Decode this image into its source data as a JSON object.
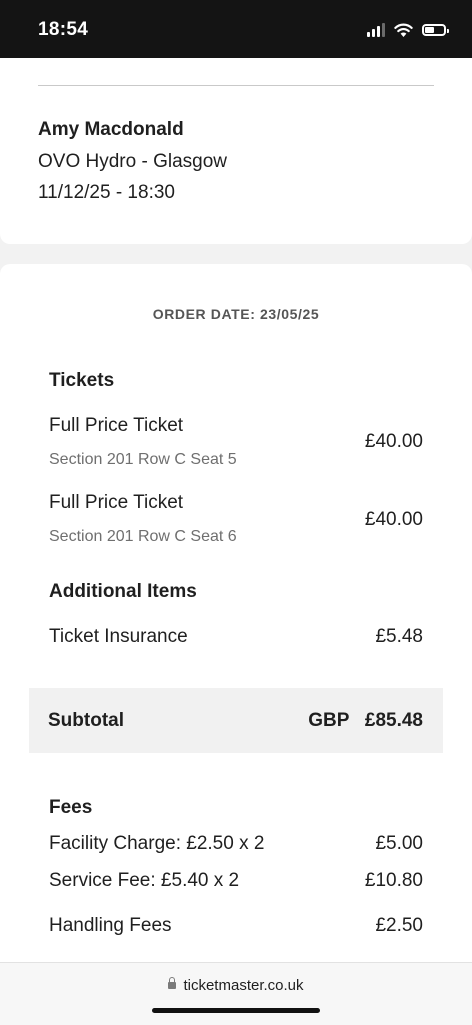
{
  "status_bar": {
    "time": "18:54"
  },
  "event": {
    "artist": "Amy Macdonald",
    "venue": "OVO Hydro - Glasgow",
    "datetime": "11/12/25 - 18:30"
  },
  "order": {
    "order_date": "ORDER DATE: 23/05/25",
    "tickets_heading": "Tickets",
    "tickets": [
      {
        "name": "Full Price Ticket",
        "seat": "Section 201  Row C  Seat 5",
        "price": "£40.00"
      },
      {
        "name": "Full Price Ticket",
        "seat": "Section 201  Row C  Seat 6",
        "price": "£40.00"
      }
    ],
    "additional_heading": "Additional Items",
    "additional_items": [
      {
        "name": "Ticket Insurance",
        "price": "£5.48"
      }
    ],
    "subtotal": {
      "label": "Subtotal",
      "value": "GBP   £85.48"
    },
    "fees_heading": "Fees",
    "fees": [
      {
        "name": "Facility Charge: £2.50 x 2",
        "price": "£5.00"
      },
      {
        "name": "Service Fee: £5.40 x 2",
        "price": "£10.80"
      },
      {
        "name": "Handling Fees",
        "price": "£2.50"
      }
    ]
  },
  "browser": {
    "url": "ticketmaster.co.uk"
  }
}
